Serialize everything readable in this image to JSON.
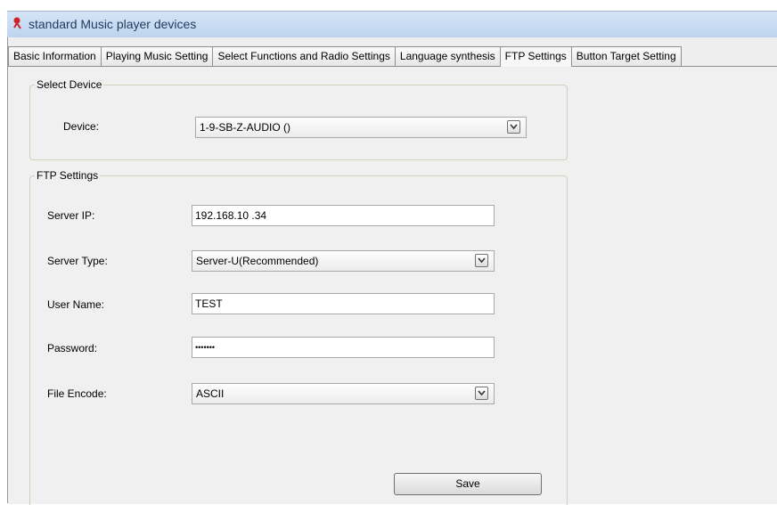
{
  "window": {
    "title": "standard Music player devices",
    "icon": "app-icon"
  },
  "tabs": [
    {
      "label": "Basic Information"
    },
    {
      "label": "Playing Music Setting"
    },
    {
      "label": "Select Functions and Radio Settings"
    },
    {
      "label": "Language synthesis"
    },
    {
      "label": "FTP Settings",
      "active": true
    },
    {
      "label": "Button Target Setting"
    }
  ],
  "select_device": {
    "legend": "Select Device",
    "device_label": "Device:",
    "device_value": "1-9-SB-Z-AUDIO ()"
  },
  "ftp": {
    "legend": "FTP Settings",
    "server_ip_label": "Server IP:",
    "server_ip_value": "192.168.10 .34",
    "server_type_label": "Server Type:",
    "server_type_value": "Server-U(Recommended)",
    "user_name_label": "User Name:",
    "user_name_value": "TEST",
    "password_label": "Password:",
    "password_value": "•••••••",
    "file_encode_label": "File Encode:",
    "file_encode_value": "ASCII",
    "save_label": "Save"
  },
  "colors": {
    "title_bar": "#c9dcf2",
    "panel": "#f0f0f0",
    "icon_red": "#d0202a"
  }
}
